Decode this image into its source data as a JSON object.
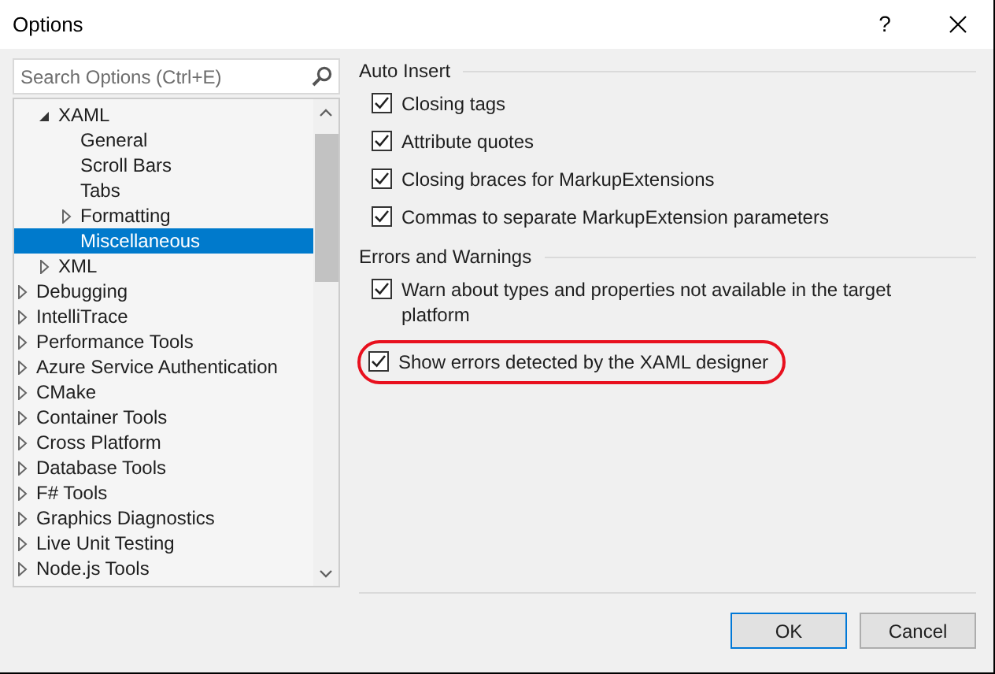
{
  "window": {
    "title": "Options",
    "help": "?"
  },
  "search": {
    "placeholder": "Search Options (Ctrl+E)"
  },
  "tree": [
    {
      "children": [
        {
          "label": "XAML",
          "expanded": true,
          "selected": false,
          "children": [
            {
              "label": "General",
              "selected": false
            },
            {
              "label": "Scroll Bars",
              "selected": false
            },
            {
              "label": "Tabs",
              "selected": false
            },
            {
              "label": "Formatting",
              "expanded": false,
              "selected": false,
              "expandable": true
            },
            {
              "label": "Miscellaneous",
              "selected": true
            }
          ]
        },
        {
          "label": "XML",
          "expanded": false,
          "selected": false,
          "expandable": true
        }
      ]
    },
    {
      "label": "Debugging",
      "expanded": false,
      "selected": false,
      "expandable": true
    },
    {
      "label": "IntelliTrace",
      "expanded": false,
      "selected": false,
      "expandable": true
    },
    {
      "label": "Performance Tools",
      "expanded": false,
      "selected": false,
      "expandable": true
    },
    {
      "label": "Azure Service Authentication",
      "expanded": false,
      "selected": false,
      "expandable": true
    },
    {
      "label": "CMake",
      "expanded": false,
      "selected": false,
      "expandable": true
    },
    {
      "label": "Container Tools",
      "expanded": false,
      "selected": false,
      "expandable": true
    },
    {
      "label": "Cross Platform",
      "expanded": false,
      "selected": false,
      "expandable": true
    },
    {
      "label": "Database Tools",
      "expanded": false,
      "selected": false,
      "expandable": true
    },
    {
      "label": "F# Tools",
      "expanded": false,
      "selected": false,
      "expandable": true
    },
    {
      "label": "Graphics Diagnostics",
      "expanded": false,
      "selected": false,
      "expandable": true
    },
    {
      "label": "Live Unit Testing",
      "expanded": false,
      "selected": false,
      "expandable": true
    },
    {
      "label": "Node.js Tools",
      "expanded": false,
      "selected": false,
      "expandable": true
    }
  ],
  "groups": [
    {
      "title": "Auto Insert",
      "options": [
        {
          "label": "Closing tags",
          "checked": true,
          "highlighted": false
        },
        {
          "label": "Attribute quotes",
          "checked": true,
          "highlighted": false
        },
        {
          "label": "Closing braces for MarkupExtensions",
          "checked": true,
          "highlighted": false
        },
        {
          "label": "Commas to separate MarkupExtension parameters",
          "checked": true,
          "highlighted": false
        }
      ]
    },
    {
      "title": "Errors and Warnings",
      "options": [
        {
          "label": "Warn about types and properties not available in the target platform",
          "checked": true,
          "highlighted": false
        },
        {
          "label": "Show errors detected by the XAML designer",
          "checked": true,
          "highlighted": true
        }
      ]
    }
  ],
  "buttons": [
    {
      "label": "OK",
      "default": true
    },
    {
      "label": "Cancel",
      "default": false
    }
  ]
}
